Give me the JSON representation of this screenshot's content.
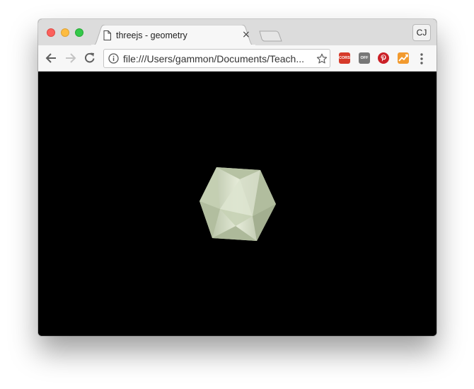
{
  "window": {
    "tab": {
      "title": "threejs - geometry",
      "close_glyph": "×"
    },
    "profile": {
      "initials": "CJ"
    }
  },
  "toolbar": {
    "url": "file:///Users/gammon/Documents/Teach...",
    "extensions": [
      {
        "name": "cors-extension-icon",
        "label": "CORS"
      },
      {
        "name": "off-extension-icon",
        "label": "OFF"
      },
      {
        "name": "pinterest-icon"
      },
      {
        "name": "chart-extension-icon"
      }
    ]
  },
  "scene": {
    "background": "#000000",
    "object": "icosahedron",
    "color": "#cfd8bf"
  },
  "colors": {
    "traffic_red": "#fc605c",
    "traffic_yellow": "#fdbc40",
    "traffic_green": "#34c84a"
  }
}
